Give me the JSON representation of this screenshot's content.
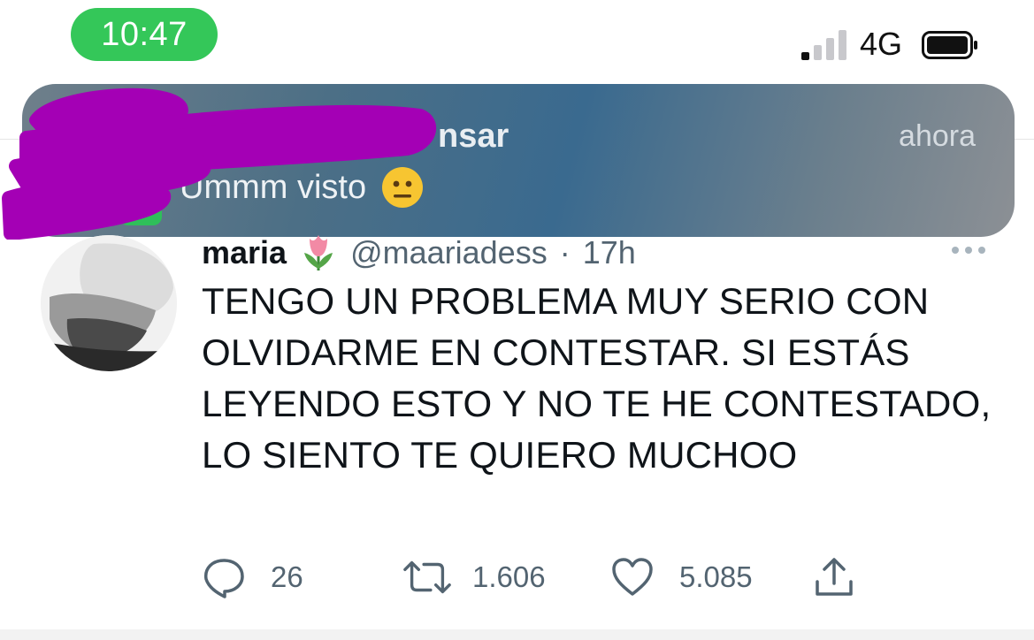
{
  "status_bar": {
    "time": "10:47",
    "network": "4G",
    "signal_bars_active": 1,
    "signal_bars_total": 4,
    "time_pill_color": "#34c759"
  },
  "notification": {
    "sender_visible": "nsar",
    "time": "ahora",
    "message": "Ummm visto",
    "message_emoji": "neutral-face",
    "app_icon": "whatsapp-icon",
    "redaction_color": "#a400b5"
  },
  "tweet": {
    "author_name": "maria",
    "name_emoji": "tulip",
    "handle": "@maariadess",
    "separator": "·",
    "age": "17h",
    "text": "TENGO UN PROBLEMA MUY SERIO CON OLVIDARME EN CONTESTAR. SI ESTÁS LEYENDO ESTO Y NO TE HE CONTESTADO, LO SIENTO TE QUIERO MUCHOO",
    "actions": {
      "replies": "26",
      "retweets": "1.606",
      "likes": "5.085"
    }
  }
}
